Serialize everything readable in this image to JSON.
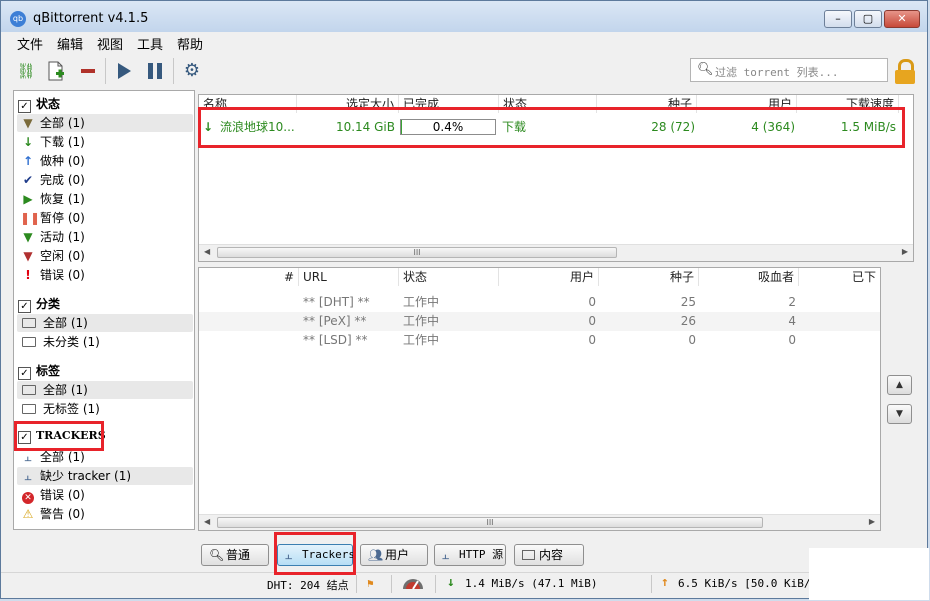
{
  "window": {
    "title": "qBittorrent v4.1.5",
    "app_icon_text": "qb",
    "controls": {
      "minimize": "–",
      "maximize": "▢",
      "close": "✕"
    }
  },
  "menu": [
    "文件",
    "编辑",
    "视图",
    "工具",
    "帮助"
  ],
  "toolbar": {
    "search_placeholder": "过滤 torrent 列表...",
    "icons": [
      "add-link-icon",
      "add-file-icon",
      "remove-icon",
      "resume-icon",
      "pause-icon",
      "options-icon",
      "lock-icon"
    ]
  },
  "sidebar": {
    "status": {
      "header": "状态",
      "items": [
        {
          "label": "全部 (1)",
          "icon": "filter-icon",
          "color": "#7a6a3a"
        },
        {
          "label": "下载 (1)",
          "icon": "download-arrow-icon",
          "color": "#2c8a1f"
        },
        {
          "label": "做种 (0)",
          "icon": "upload-arrow-icon",
          "color": "#2f6fd0"
        },
        {
          "label": "完成 (0)",
          "icon": "checkmark-icon",
          "color": "#1f3c8a"
        },
        {
          "label": "恢复 (1)",
          "icon": "play-icon",
          "color": "#2c8a1f"
        },
        {
          "label": "暂停 (0)",
          "icon": "pause-icon",
          "color": "#e0634d"
        },
        {
          "label": "活动 (1)",
          "icon": "filter-icon",
          "color": "#2c8a1f"
        },
        {
          "label": "空闲 (0)",
          "icon": "filter-icon",
          "color": "#b03030"
        },
        {
          "label": "错误 (0)",
          "icon": "exclamation-icon",
          "color": "#e0000f"
        }
      ]
    },
    "categories": {
      "header": "分类",
      "items": [
        "全部 (1)",
        "未分类 (1)"
      ]
    },
    "tags": {
      "header": "标签",
      "items": [
        "全部 (1)",
        "无标签 (1)"
      ]
    },
    "trackers": {
      "header": "TRACKERS",
      "items": [
        {
          "label": "全部 (1)",
          "icon": "tracker-icon"
        },
        {
          "label": "缺少 tracker (1)",
          "icon": "tracker-icon"
        },
        {
          "label": "错误 (0)",
          "icon": "error-circle-icon"
        },
        {
          "label": "警告 (0)",
          "icon": "warning-icon"
        }
      ]
    }
  },
  "torrent_list": {
    "columns": [
      "名称",
      "选定大小",
      "已完成",
      "状态",
      "种子",
      "用户",
      "下载速度"
    ],
    "rows": [
      {
        "name": "流浪地球10...",
        "size": "10.14 GiB",
        "progress_text": "0.4%",
        "progress": 0.004,
        "status": "下载",
        "seeds": "28 (72)",
        "peers": "4 (364)",
        "dl_speed": "1.5 MiB/s"
      }
    ]
  },
  "trackers_table": {
    "columns": [
      "#",
      "URL",
      "状态",
      "用户",
      "种子",
      "吸血者",
      "已下"
    ],
    "rows": [
      {
        "url": "** [DHT] **",
        "status": "工作中",
        "peers": "0",
        "seeds": "25",
        "leechers": "2"
      },
      {
        "url": "** [PeX] **",
        "status": "工作中",
        "peers": "0",
        "seeds": "26",
        "leechers": "4"
      },
      {
        "url": "** [LSD] **",
        "status": "工作中",
        "peers": "0",
        "seeds": "0",
        "leechers": "0"
      }
    ]
  },
  "detail_tabs": [
    "普通",
    "Trackers",
    "用户",
    "HTTP 源",
    "内容"
  ],
  "scroll_thumb_text": "III",
  "statusbar": {
    "dht": "DHT: 204 结点",
    "download": "1.4  MiB/s (47.1  MiB)",
    "upload": "6.5  KiB/s [50.0  KiB/"
  }
}
